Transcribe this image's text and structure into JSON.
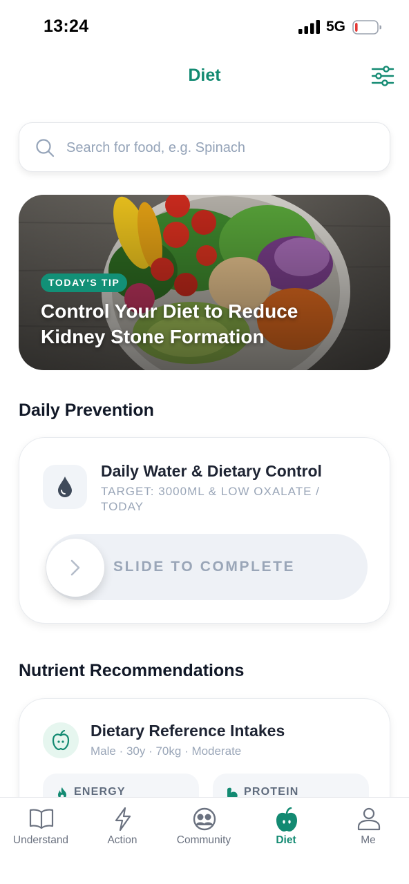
{
  "status_bar": {
    "time": "13:24",
    "network": "5G",
    "battery_level": 0.12
  },
  "header": {
    "title": "Diet"
  },
  "search": {
    "placeholder": "Search for food, e.g. Spinach"
  },
  "hero": {
    "badge": "TODAY'S TIP",
    "title": "Control Your Diet to Reduce Kidney Stone Formation"
  },
  "daily_prevention": {
    "section_title": "Daily Prevention",
    "card": {
      "title": "Daily Water & Dietary Control",
      "subtitle": "TARGET: 3000ML & LOW OXALATE / TODAY",
      "slider_label": "SLIDE TO COMPLETE",
      "icon": "water-drop-icon"
    }
  },
  "nutrients": {
    "section_title": "Nutrient Recommendations",
    "card": {
      "title": "Dietary Reference Intakes",
      "subtitle": "Male · 30y · 70kg · Moderate",
      "icon": "apple-icon",
      "chips": [
        {
          "label": "ENERGY",
          "icon": "flame-icon"
        },
        {
          "label": "PROTEIN",
          "icon": "muscle-icon"
        }
      ]
    }
  },
  "tabbar": {
    "tabs": [
      {
        "label": "Understand",
        "icon": "book-icon"
      },
      {
        "label": "Action",
        "icon": "lightning-icon"
      },
      {
        "label": "Community",
        "icon": "community-icon"
      },
      {
        "label": "Diet",
        "icon": "apple-icon",
        "active": true
      },
      {
        "label": "Me",
        "icon": "person-icon"
      }
    ]
  },
  "colors": {
    "accent": "#138a72",
    "muted": "#9aa6b8",
    "badge": "#129077"
  }
}
